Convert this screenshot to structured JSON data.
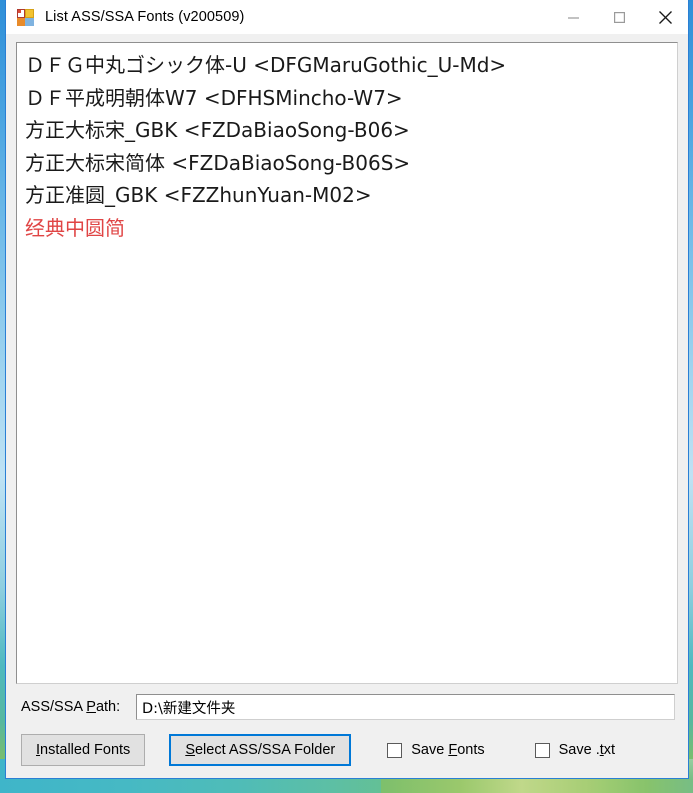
{
  "window": {
    "title": "List ASS/SSA Fonts (v200509)",
    "icon": "app-grid-icon",
    "caption": {
      "minimize_label": "─",
      "maximize_label": "□",
      "close_label": "✕"
    }
  },
  "font_list": {
    "items": [
      {
        "text": "ＤＦＧ中丸ゴシック体-U <DFGMaruGothic_U-Md>",
        "missing": false
      },
      {
        "text": "ＤＦ平成明朝体W7 <DFHSMincho-W7>",
        "missing": false
      },
      {
        "text": "方正大标宋_GBK <FZDaBiaoSong-B06>",
        "missing": false
      },
      {
        "text": "方正大标宋简体 <FZDaBiaoSong-B06S>",
        "missing": false
      },
      {
        "text": "方正准圆_GBK <FZZhunYuan-M02>",
        "missing": false
      },
      {
        "text": "经典中圆简",
        "missing": true
      }
    ],
    "missing_color": "#e04545"
  },
  "path_row": {
    "label_before": "ASS/SSA ",
    "label_mnemonic": "P",
    "label_after": "ath:",
    "value": "D:\\新建文件夹",
    "placeholder": ""
  },
  "controls": {
    "installed_button": {
      "before": "",
      "mnemonic": "I",
      "after": "nstalled Fonts"
    },
    "select_button": {
      "before": "",
      "mnemonic": "S",
      "after": "elect ASS/SSA Folder",
      "is_default": true,
      "focus_color": "#0078d7"
    },
    "save_fonts_checkbox": {
      "before": "Save ",
      "mnemonic": "F",
      "after": "onts",
      "checked": false
    },
    "save_txt_checkbox": {
      "before": "Save .",
      "mnemonic": "t",
      "after": "xt",
      "checked": false
    }
  }
}
